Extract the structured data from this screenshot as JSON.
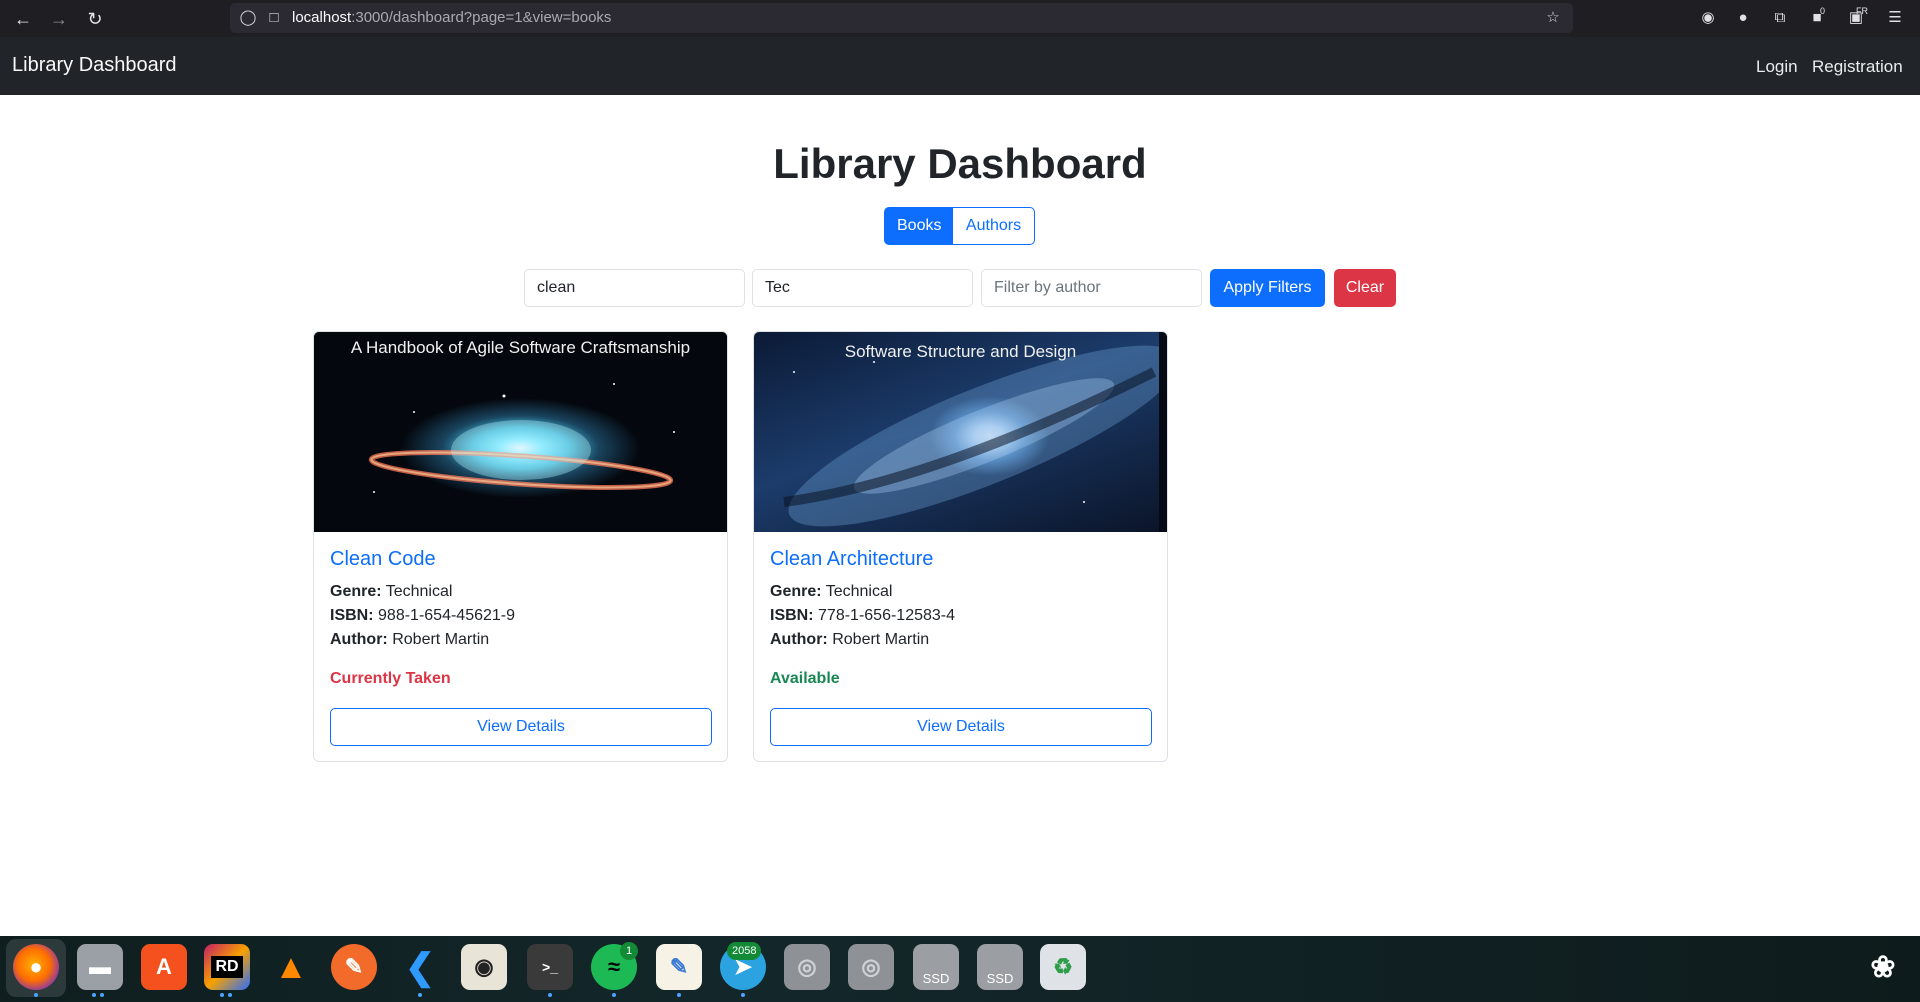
{
  "browser": {
    "url_host": "localhost",
    "url_rest": ":3000/dashboard?page=1&view=books",
    "icons": [
      "back-icon",
      "forward-icon",
      "reload-icon",
      "shield-icon",
      "page-icon",
      "star-icon",
      "pocket-icon",
      "account-icon",
      "extensions-icon",
      "extension-badge-icon",
      "extension-fr-icon",
      "menu-icon"
    ],
    "ext_badge": "0",
    "ext_fr": "FR"
  },
  "navbar": {
    "brand": "Library Dashboard",
    "login": "Login",
    "registration": "Registration"
  },
  "main": {
    "title": "Library Dashboard",
    "tabs": [
      {
        "label": "Books",
        "active": true
      },
      {
        "label": "Authors",
        "active": false
      }
    ],
    "filters": {
      "title_value": "clean",
      "genre_value": "Tec",
      "author_placeholder": "Filter by author",
      "apply_label": "Apply Filters",
      "clear_label": "Clear"
    },
    "books": [
      {
        "cover_caption": "A Handbook of Agile Software Craftsmanship",
        "title": "Clean Code",
        "genre_label": "Genre:",
        "genre": "Technical",
        "isbn_label": "ISBN:",
        "isbn": "988-1-654-45621-9",
        "author_label": "Author:",
        "author": "Robert Martin",
        "status": "Currently Taken",
        "status_color": "#dc3545",
        "button": "View Details"
      },
      {
        "cover_caption": "Software Structure and Design",
        "title": "Clean Architecture",
        "genre_label": "Genre:",
        "genre": "Technical",
        "isbn_label": "ISBN:",
        "isbn": "778-1-656-12583-4",
        "author_label": "Author:",
        "author": "Robert Martin",
        "status": "Available",
        "status_color": "#198754",
        "button": "View Details"
      }
    ]
  },
  "dock": {
    "apps": [
      "firefox-icon",
      "files-icon",
      "app-center-icon",
      "rider-icon",
      "vlc-icon",
      "inkscape-icon",
      "vscode-icon",
      "rhythmbox-icon",
      "terminal-icon",
      "spotify-icon",
      "text-editor-icon",
      "telegram-icon",
      "disk-icon",
      "disk-icon-2",
      "ssd-icon",
      "ssd-icon-2",
      "trash-icon",
      "ubuntu-logo-icon"
    ],
    "rider_label": "RD",
    "spotify_badge": "1",
    "telegram_badge": "2058",
    "ssd_label": "SSD"
  },
  "colors": {
    "primary": "#0d6efd",
    "danger": "#dc3545",
    "success": "#198754",
    "navbar_bg": "#212529"
  }
}
